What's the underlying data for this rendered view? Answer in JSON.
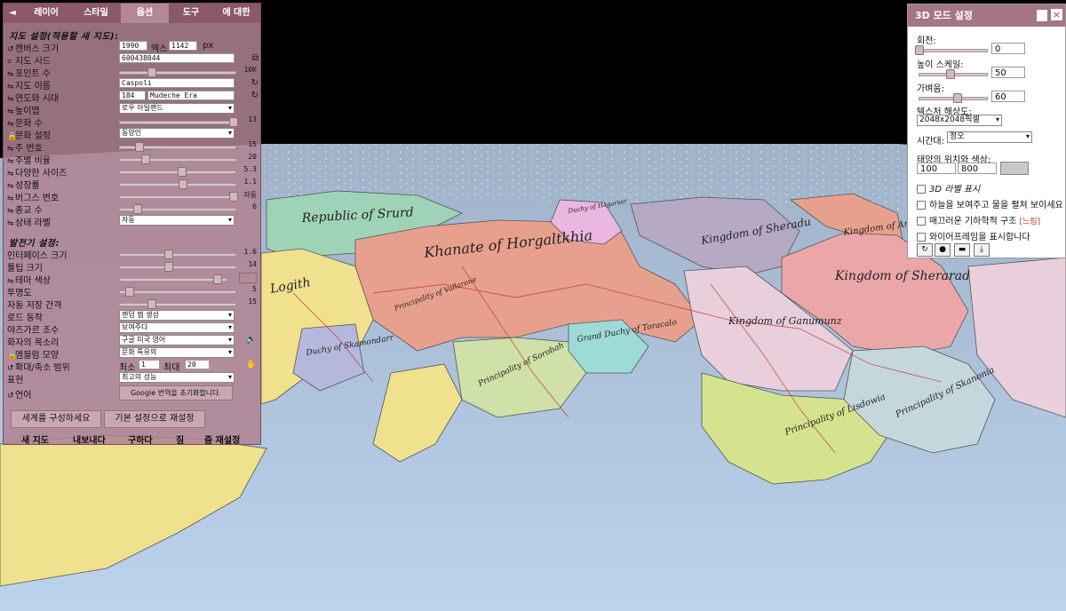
{
  "tabs": [
    "◄",
    "레이어",
    "스타일",
    "옵션",
    "도구",
    "에 대한"
  ],
  "sections": {
    "map_settings": "지도 설정(적용할 새 지도):",
    "generator": "발전기 설정:"
  },
  "map_rows": [
    {
      "label": "캔버스 크기",
      "w": "1990",
      "unit1": "엑스",
      "h": "1142",
      "unit2": "px"
    },
    {
      "label": "지도 시드",
      "value": "600438044"
    },
    {
      "label": "포인트 수",
      "value": "10K",
      "slider": 0.27
    },
    {
      "label": "지도 이름",
      "value": "Caspoli"
    },
    {
      "label": "연도와 시대",
      "year": "184",
      "era": "Mudeche Era"
    },
    {
      "label": "높이맵",
      "value": "로우 아일랜드"
    },
    {
      "label": "문화 수",
      "value": "13",
      "slider": 0.97
    },
    {
      "label": "문화 설정",
      "value": "동양인"
    },
    {
      "label": "주 번호",
      "value": "15",
      "slider": 0.17
    },
    {
      "label": "주별 비율",
      "value": "20",
      "slider": 0.22
    },
    {
      "label": "다양한 사이즈",
      "value": "5.3",
      "slider": 0.53
    },
    {
      "label": "성장률",
      "value": "1.1",
      "slider": 0.54
    },
    {
      "label": "버그스 번호",
      "value": "자동",
      "slider": 0.97
    },
    {
      "label": "종교 수",
      "value": "6",
      "slider": 0.15
    },
    {
      "label": "상태 라벨",
      "value": "자동"
    }
  ],
  "gen_rows": [
    {
      "label": "인터페이스 크기",
      "value": "1.6",
      "slider": 0.42
    },
    {
      "label": "툴팁 크기",
      "value": "14",
      "slider": 0.42
    },
    {
      "label": "테마 색상",
      "color": "#b68a98"
    },
    {
      "label": "투명도",
      "value": "5",
      "slider": 0.08
    },
    {
      "label": "자동 저장 간격",
      "value": "15",
      "slider": 0.27
    },
    {
      "label": "로드 동작",
      "value": "랜덤 맵 생성"
    },
    {
      "label": "야즈가르 조수",
      "value": "보여주다"
    },
    {
      "label": "화자의 목소리",
      "value": "구글 미국 영어"
    },
    {
      "label": "엠블럼 모양",
      "value": "문화 특유의"
    },
    {
      "label": "확대/축소 범위",
      "min_label": "최소",
      "min": "1",
      "max_label": "최대",
      "max": "20"
    },
    {
      "label": "표현",
      "value": "최고의 성능"
    },
    {
      "label": "언어",
      "button": "Google 번역을 초기화합니다."
    }
  ],
  "actions": {
    "build": "세계를 구성하세요",
    "reset": "기본 설정으로 재설정"
  },
  "bottom": [
    "새 지도",
    "내보내다",
    "구하다",
    "짐",
    "줌 재설정"
  ],
  "panel3d": {
    "title": "3D 모드 설정",
    "rotation_label": "회전:",
    "rotation": "0",
    "rotation_slider": 0.0,
    "height_label": "높이 스케일:",
    "height": "50",
    "height_slider": 0.45,
    "light_label": "가벼움:",
    "light": "60",
    "light_slider": 0.55,
    "texture_label": "텍스처 해상도:",
    "texture": "2048x2048픽셀",
    "time_label": "시간대:",
    "time": "정오",
    "sun_label": "태양의 위치와 색상:",
    "sun_x": "100",
    "sun_y": "800",
    "sun_color": "#c8c8c8",
    "checks": [
      "3D 라벨 표시",
      "하늘을 보여주고 물을 펼쳐 보이세요",
      "매끄러운 기하학적 구조",
      "와이어프레임을 표시합니다"
    ],
    "slow": "[느림]"
  },
  "map_labels": [
    {
      "text": "Republic of Srurd"
    },
    {
      "text": "Khanate of Horgaltkhia"
    },
    {
      "text": "Kingdom of Sheradu"
    },
    {
      "text": "Kingdom of Sherarad"
    },
    {
      "text": "Kingdom of Ganumunz"
    },
    {
      "text": "Principality of Vallarone"
    },
    {
      "text": "Principality of Sorobah"
    },
    {
      "text": "Grand Duchy of Toracalo"
    },
    {
      "text": "Principality of Lisdowia"
    },
    {
      "text": "Principality of Skanonia"
    },
    {
      "text": "Duchy of Skamondarr"
    },
    {
      "text": "Kingdom of Andan"
    },
    {
      "text": "Duchy of Hagarsor"
    },
    {
      "text": "Logith"
    }
  ]
}
